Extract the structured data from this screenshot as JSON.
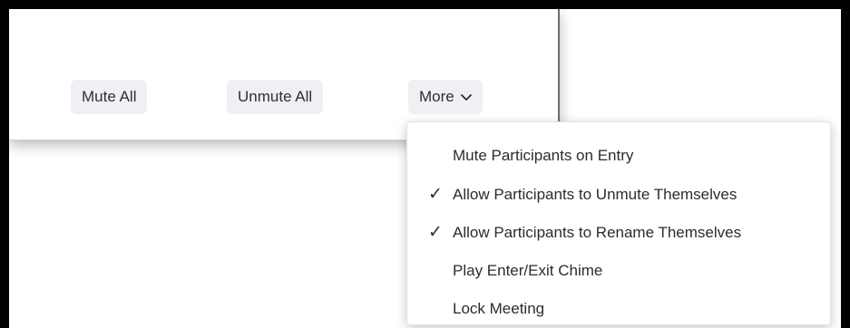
{
  "panel": {
    "mute_all_label": "Mute All",
    "unmute_all_label": "Unmute All",
    "more_label": "More",
    "more_icon": "chevron-down-icon"
  },
  "more_menu": {
    "items": [
      {
        "label": "Mute Participants on Entry",
        "checked": false
      },
      {
        "label": "Allow Participants to Unmute Themselves",
        "checked": true
      },
      {
        "label": "Allow Participants to Rename Themselves",
        "checked": true
      },
      {
        "label": "Play Enter/Exit Chime",
        "checked": false
      },
      {
        "label": "Lock Meeting",
        "checked": false
      }
    ],
    "check_glyph": "✓"
  },
  "colors": {
    "button_bg": "#eef0f4",
    "text": "#2b2c30",
    "frame": "#000000"
  }
}
